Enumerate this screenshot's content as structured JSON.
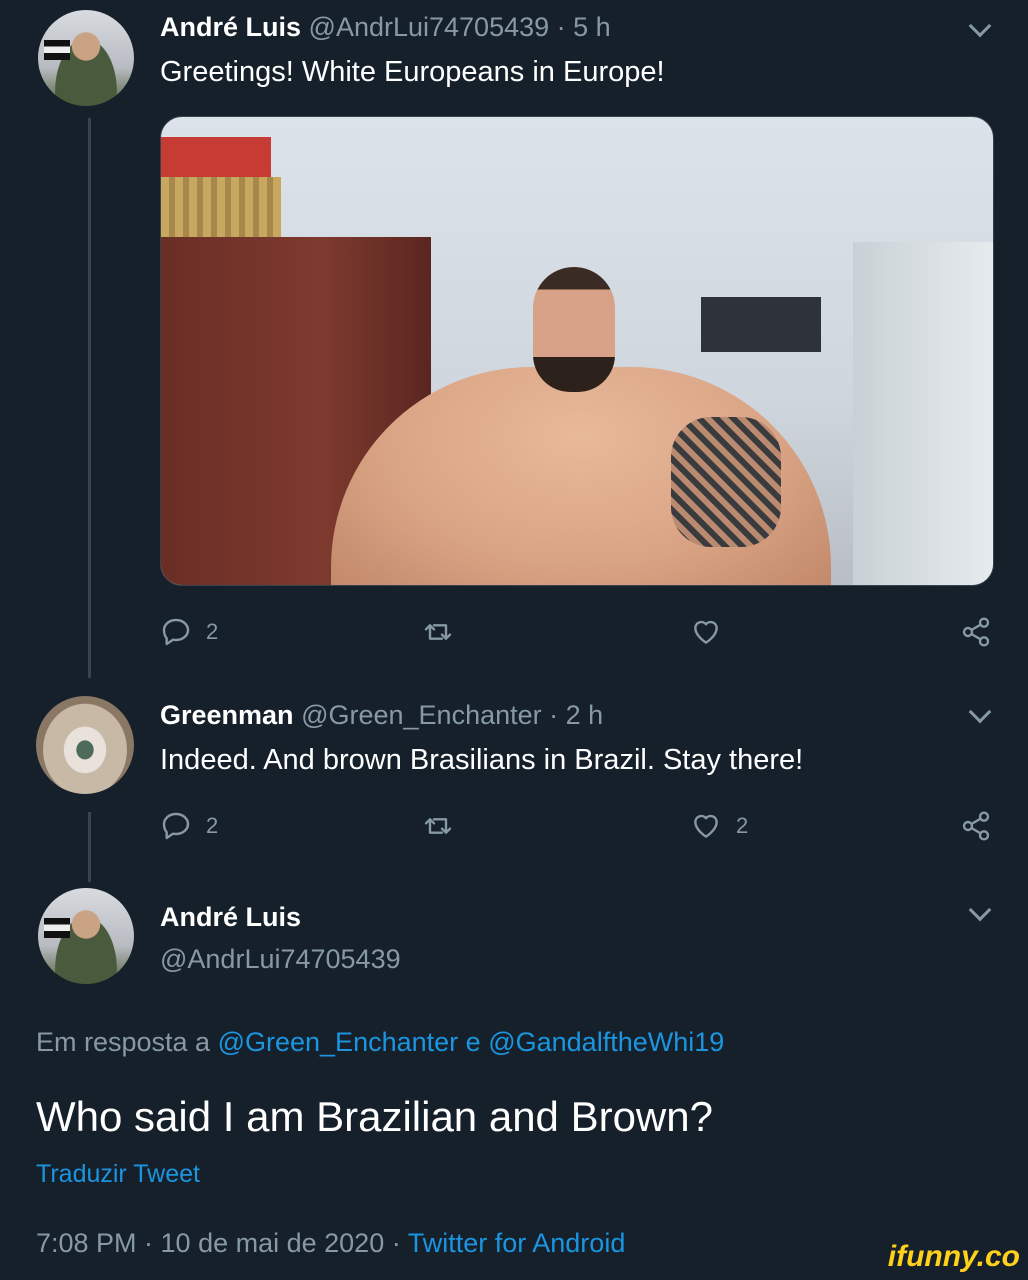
{
  "tweets": [
    {
      "name": "André Luis",
      "handle": "@AndrLui74705439",
      "time": "· 5 h",
      "text": "Greetings! White Europeans in Europe!",
      "replies": "2",
      "retweets": "",
      "likes": ""
    },
    {
      "name": "Greenman",
      "handle": "@Green_Enchanter",
      "time": "· 2 h",
      "text": "Indeed. And brown Brasilians in Brazil. Stay there!",
      "replies": "2",
      "retweets": "",
      "likes": "2"
    }
  ],
  "main_tweet": {
    "name": "André Luis",
    "handle": "@AndrLui74705439",
    "reply_prefix": "Em resposta a",
    "reply_user1": "@Green_Enchanter",
    "reply_join": "e",
    "reply_user2": "@GandalftheWhi19",
    "text": "Who said I am Brazilian and Brown?",
    "translate": "Traduzir Tweet",
    "timestamp": "7:08 PM · 10 de mai de 2020 ·",
    "client": "Twitter for Android"
  },
  "watermark": "ifunny.co",
  "colors": {
    "background": "#15202b",
    "secondary_text": "#8899a6",
    "link": "#1b95e0"
  }
}
